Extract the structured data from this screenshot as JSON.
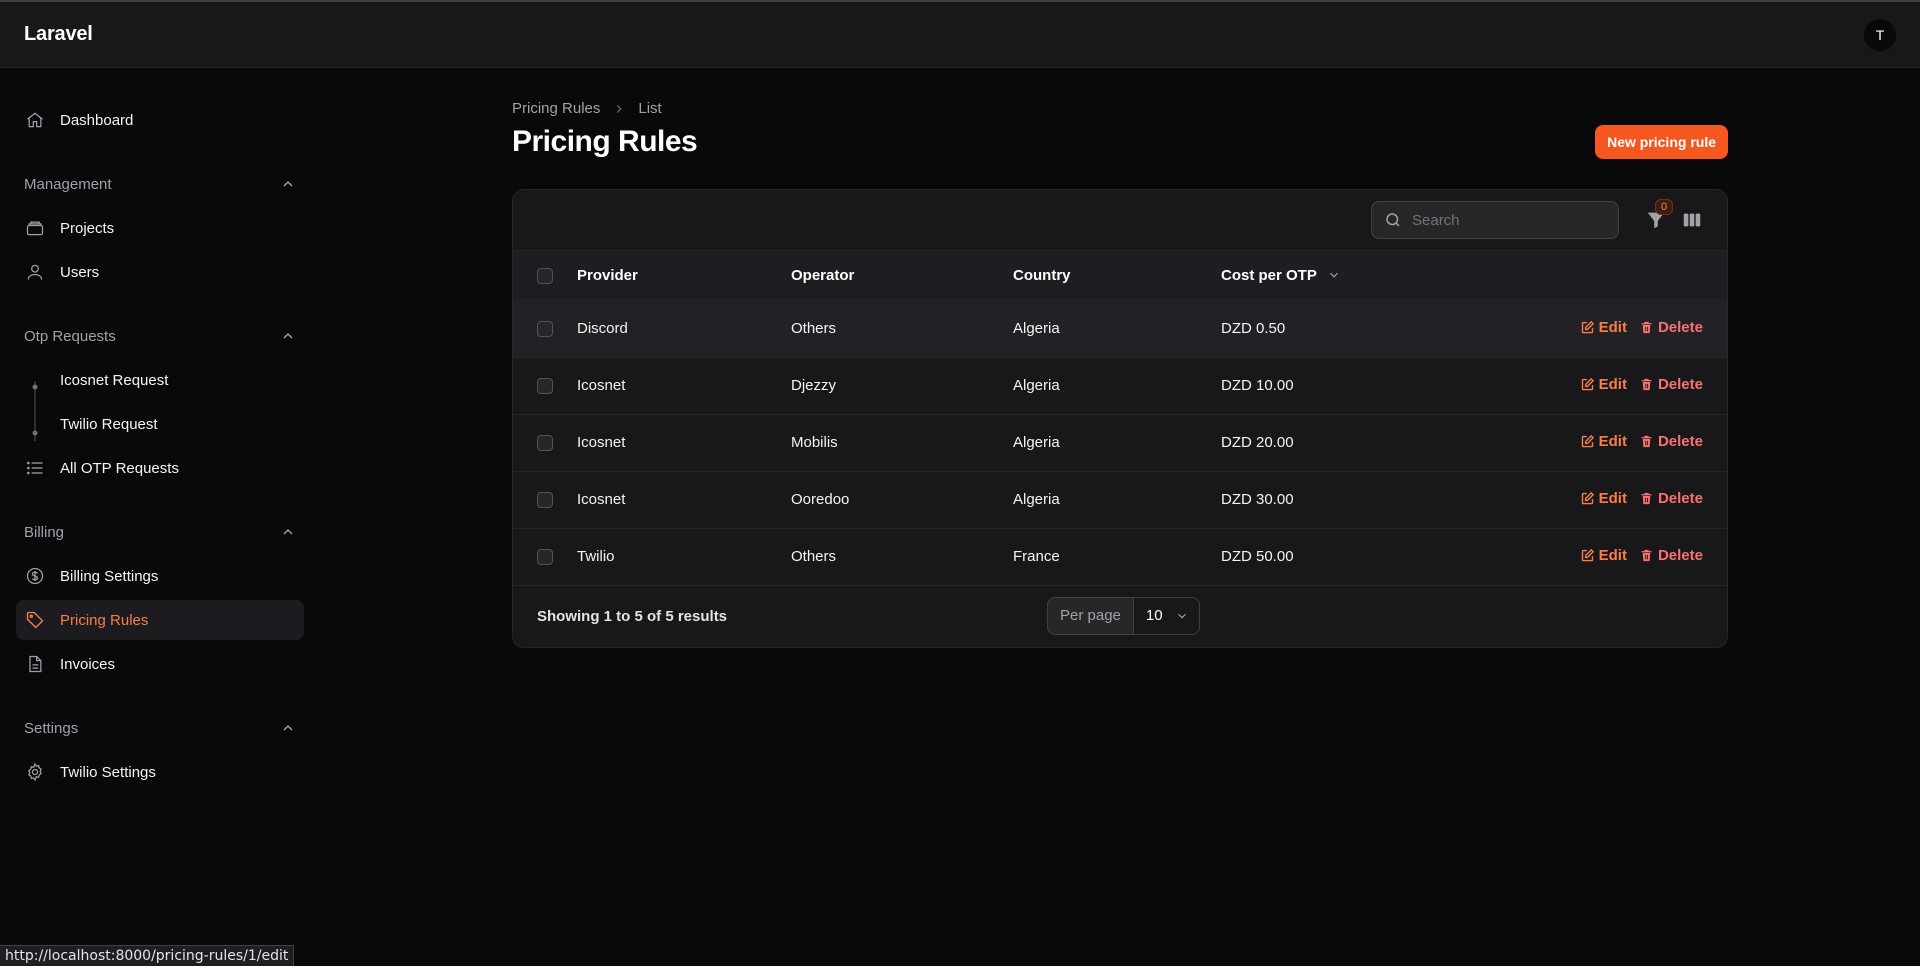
{
  "app": {
    "brand": "Laravel",
    "user_initial": "T"
  },
  "sidebar": {
    "dashboard": {
      "label": "Dashboard",
      "icon": "home-icon"
    },
    "groups": [
      {
        "label": "Management",
        "items": [
          {
            "label": "Projects",
            "icon": "stack-icon"
          },
          {
            "label": "Users",
            "icon": "user-icon"
          }
        ]
      },
      {
        "label": "Otp Requests",
        "items": [
          {
            "label": "Icosnet Request"
          },
          {
            "label": "Twilio Request"
          },
          {
            "label": "All OTP Requests",
            "icon": "list-icon"
          }
        ]
      },
      {
        "label": "Billing",
        "items": [
          {
            "label": "Billing Settings",
            "icon": "dollar-icon"
          },
          {
            "label": "Pricing Rules",
            "icon": "tag-icon",
            "active": true
          },
          {
            "label": "Invoices",
            "icon": "document-icon"
          }
        ]
      },
      {
        "label": "Settings",
        "items": [
          {
            "label": "Twilio Settings",
            "icon": "gear-icon"
          }
        ]
      }
    ]
  },
  "breadcrumb": {
    "parent": "Pricing Rules",
    "current": "List"
  },
  "page": {
    "title": "Pricing Rules",
    "new_button": "New pricing rule"
  },
  "toolbar": {
    "search_placeholder": "Search",
    "filter_count": "0"
  },
  "table": {
    "columns": {
      "provider": "Provider",
      "operator": "Operator",
      "country": "Country",
      "cost": "Cost per OTP"
    },
    "rows": [
      {
        "provider": "Discord",
        "operator": "Others",
        "country": "Algeria",
        "cost": "DZD 0.50"
      },
      {
        "provider": "Icosnet",
        "operator": "Djezzy",
        "country": "Algeria",
        "cost": "DZD 10.00"
      },
      {
        "provider": "Icosnet",
        "operator": "Mobilis",
        "country": "Algeria",
        "cost": "DZD 20.00"
      },
      {
        "provider": "Icosnet",
        "operator": "Ooredoo",
        "country": "Algeria",
        "cost": "DZD 30.00"
      },
      {
        "provider": "Twilio",
        "operator": "Others",
        "country": "France",
        "cost": "DZD 50.00"
      }
    ],
    "edit_label": "Edit",
    "delete_label": "Delete"
  },
  "footer": {
    "showing": "Showing 1 to 5 of 5 results",
    "per_page_label": "Per page",
    "per_page_value": "10"
  },
  "statusbar": {
    "url": "http://localhost:8000/pricing-rules/1/edit"
  },
  "colors": {
    "accent": "#f4571f",
    "accent_text": "#fb7d4a",
    "danger": "#f87171",
    "background": "#09090b",
    "surface": "#18181b"
  }
}
